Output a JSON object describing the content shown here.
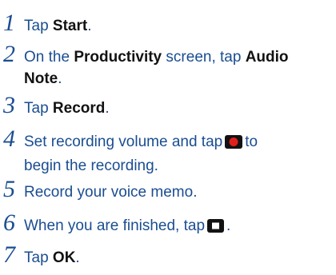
{
  "steps": [
    {
      "number": "1",
      "pre": "Tap ",
      "bold1": "Start",
      "post": "."
    },
    {
      "number": "2",
      "pre": "On the ",
      "bold1": "Productivity",
      "mid": " screen, tap ",
      "bold2": "Audio",
      "bold3": "Note",
      "post": "."
    },
    {
      "number": "3",
      "pre": "Tap ",
      "bold1": "Record",
      "post": "."
    },
    {
      "number": "4",
      "pre": "Set recording volume and tap",
      "post": "to",
      "line2": "begin the recording.",
      "icon": "record-button-icon",
      "icon_color": "#e0201c"
    },
    {
      "number": "5",
      "text": "Record your voice memo."
    },
    {
      "number": "6",
      "pre": "When you are finished, tap",
      "post": ".",
      "icon": "stop-button-icon"
    },
    {
      "number": "7",
      "pre": "Tap ",
      "bold1": "OK",
      "post": "."
    }
  ]
}
